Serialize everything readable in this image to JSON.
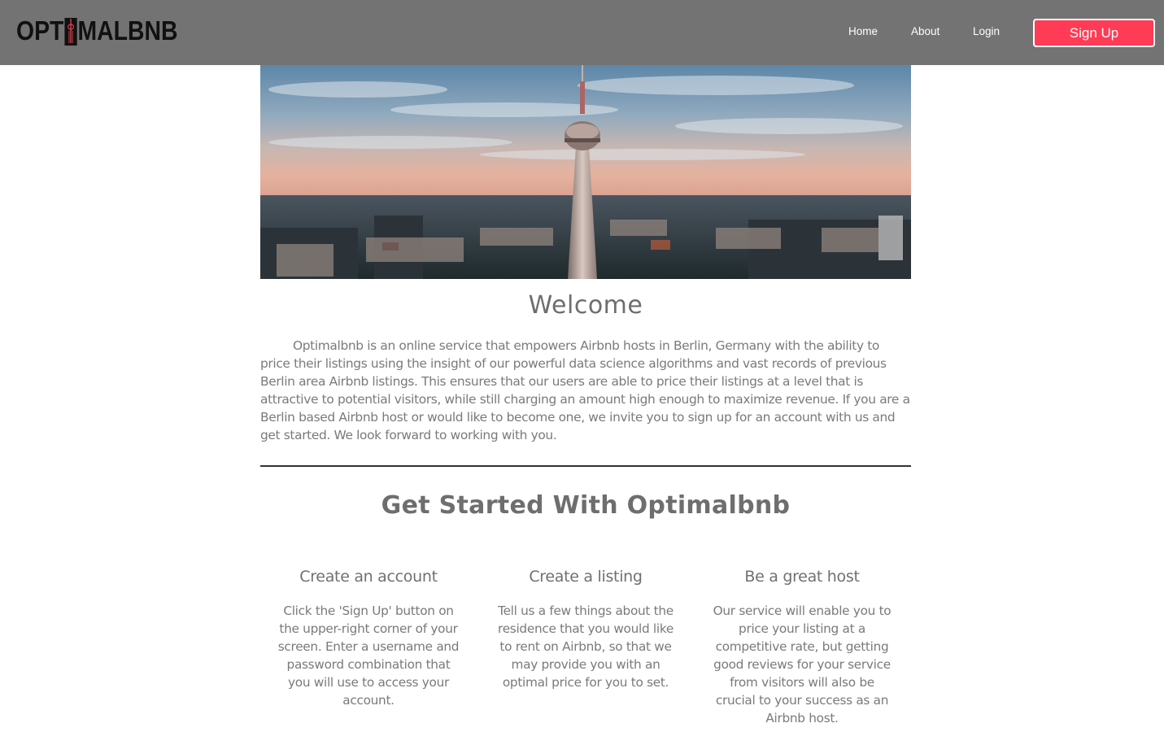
{
  "header": {
    "logo_text_left": "OPT",
    "logo_text_right": "MALBNB",
    "nav": [
      {
        "label": "Home"
      },
      {
        "label": "About"
      },
      {
        "label": "Login"
      }
    ],
    "signup_label": "Sign Up",
    "colors": {
      "header_bg": "#737373",
      "accent": "#ff3b55"
    }
  },
  "hero": {
    "image_subject": "berlin-tv-tower-skyline"
  },
  "welcome": {
    "title": "Welcome",
    "body": "Optimalbnb is an online service that empowers Airbnb hosts in Berlin, Germany with the ability to price their listings using the insight of our powerful data science algorithms and vast records of previous Berlin area Airbnb listings. This ensures that our users are able to price their listings at a level that is attractive to potential visitors, while still charging an amount high enough to maximize revenue. If you are a Berlin based Airbnb host or would like to become one, we invite you to sign up for an account with us and get started. We look forward to working with you."
  },
  "get_started": {
    "title": "Get Started With Optimalbnb",
    "steps": [
      {
        "title": "Create an account",
        "body": "Click the 'Sign Up' button on the upper-right corner of your screen. Enter a username and password combination that you will use to access your account."
      },
      {
        "title": "Create a listing",
        "body": "Tell us a few things about the residence that you would like to rent on Airbnb, so that we may provide you with an optimal price for you to set."
      },
      {
        "title": "Be a great host",
        "body": "Our service will enable you to price your listing at a competitive rate, but getting good reviews for your service from visitors will also be crucial to your success as an Airbnb host."
      }
    ]
  }
}
